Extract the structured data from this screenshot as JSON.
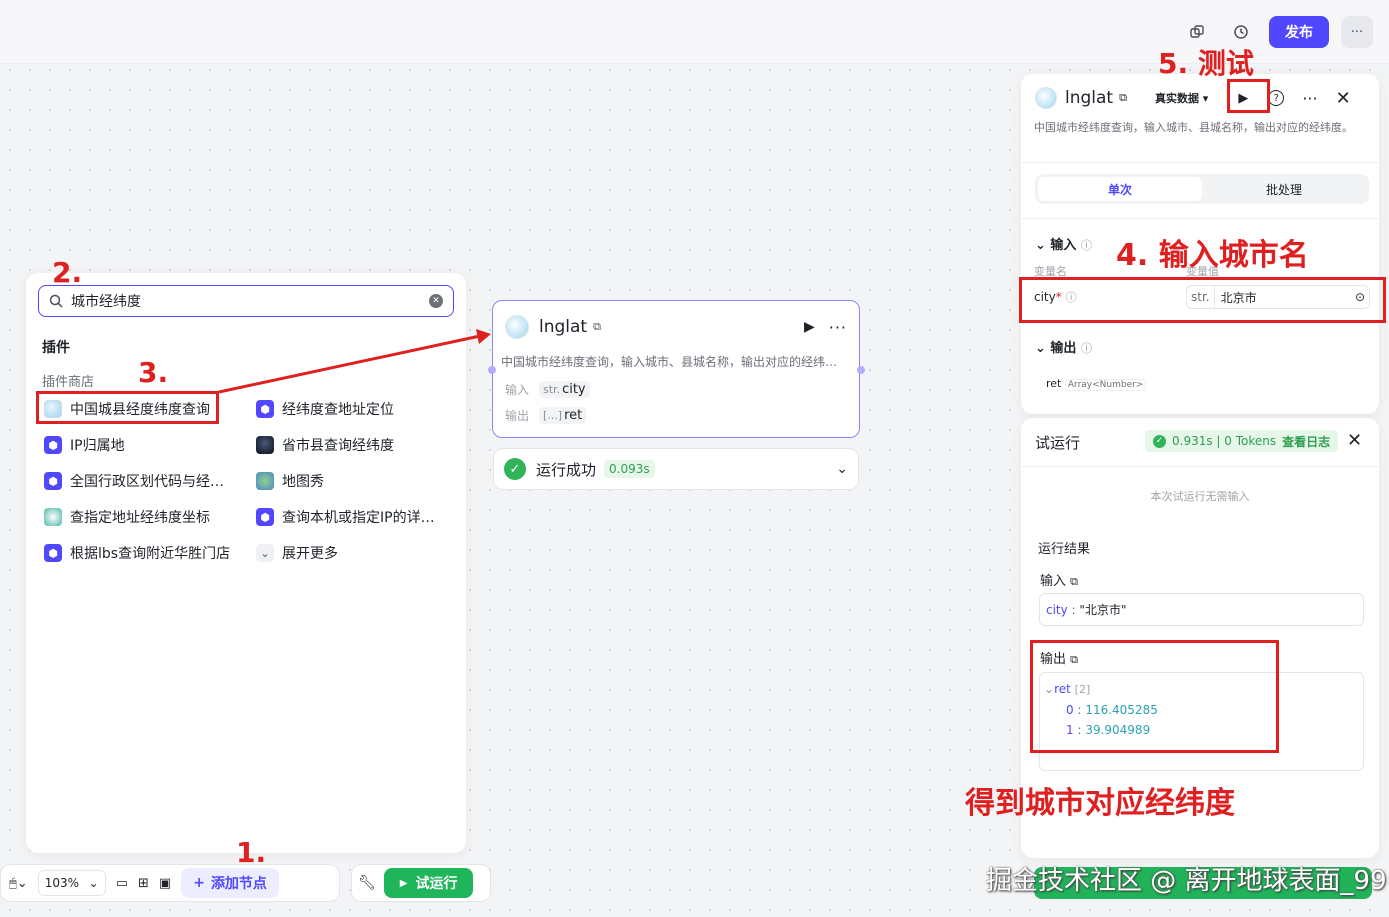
{
  "topbar": {
    "publish_label": "发布",
    "more_label": "···"
  },
  "left_panel": {
    "search_value": "城市经纬度",
    "section_plugins": "插件",
    "section_store": "插件商店",
    "items_left": [
      {
        "label": "中国城县经度纬度查询",
        "icon": "globe-icon"
      },
      {
        "label": "IP归属地",
        "icon": "cube-icon"
      },
      {
        "label": "全国行政区划代码与经…",
        "icon": "cube-icon"
      },
      {
        "label": "查指定地址经纬度坐标",
        "icon": "swirl-icon"
      },
      {
        "label": "根据lbs查询附近华胜门店",
        "icon": "cube-icon"
      }
    ],
    "items_right": [
      {
        "label": "经纬度查地址定位",
        "icon": "cube-icon"
      },
      {
        "label": "省市县查询经纬度",
        "icon": "dark-globe-icon"
      },
      {
        "label": "地图秀",
        "icon": "map-icon"
      },
      {
        "label": "查询本机或指定IP的详…",
        "icon": "cube-icon"
      },
      {
        "label": "展开更多",
        "icon": "chevron-down-icon"
      }
    ]
  },
  "node": {
    "title": "lnglat",
    "description": "中国城市经纬度查询，输入城市、县城名称，输出对应的经纬…",
    "input_label": "输入",
    "input_type": "str.",
    "input_name": "city",
    "output_label": "输出",
    "output_type": "[...]",
    "output_name": "ret",
    "run_status": "运行成功",
    "run_time": "0.093s"
  },
  "bottom_bar": {
    "zoom": "103%",
    "add_node_label": "添加节点",
    "trial_run_label": "试运行"
  },
  "right_panel": {
    "title": "lnglat",
    "data_mode": "真实数据",
    "description": "中国城市经纬度查询，输入城市、县城名称，输出对应的经纬度。",
    "tab_single": "单次",
    "tab_batch": "批处理",
    "input_section": "输入",
    "col_var_name": "变量名",
    "col_var_value": "变量值",
    "var_name": "city",
    "var_required": "*",
    "var_type": "str.",
    "var_value": "北京市",
    "output_section": "输出",
    "output_var": "ret",
    "output_type": "Array<Number>"
  },
  "trial_panel": {
    "title": "试运行",
    "stats": "0.931s | 0 Tokens",
    "view_log": "查看日志",
    "no_input_hint": "本次试运行无需输入",
    "result_title": "运行结果",
    "input_title": "输入",
    "input_key": "city",
    "input_value": "\"北京市\"",
    "output_title": "输出",
    "output_key": "ret",
    "output_count": "[2]",
    "output_items": [
      {
        "index": "0",
        "value": "116.405285"
      },
      {
        "index": "1",
        "value": "39.904989"
      }
    ]
  },
  "annotations": {
    "step1": "1.",
    "step2": "2.",
    "step3": "3.",
    "step4": "4. 输入城市名",
    "step5": "5. 测试",
    "result_note": "得到城市对应经纬度",
    "color": "#e02020"
  },
  "watermark": "掘金技术社区 @ 离开地球表面_99",
  "colors": {
    "accent": "#5147ff",
    "success": "#32b35a",
    "annotation": "#e02020"
  }
}
